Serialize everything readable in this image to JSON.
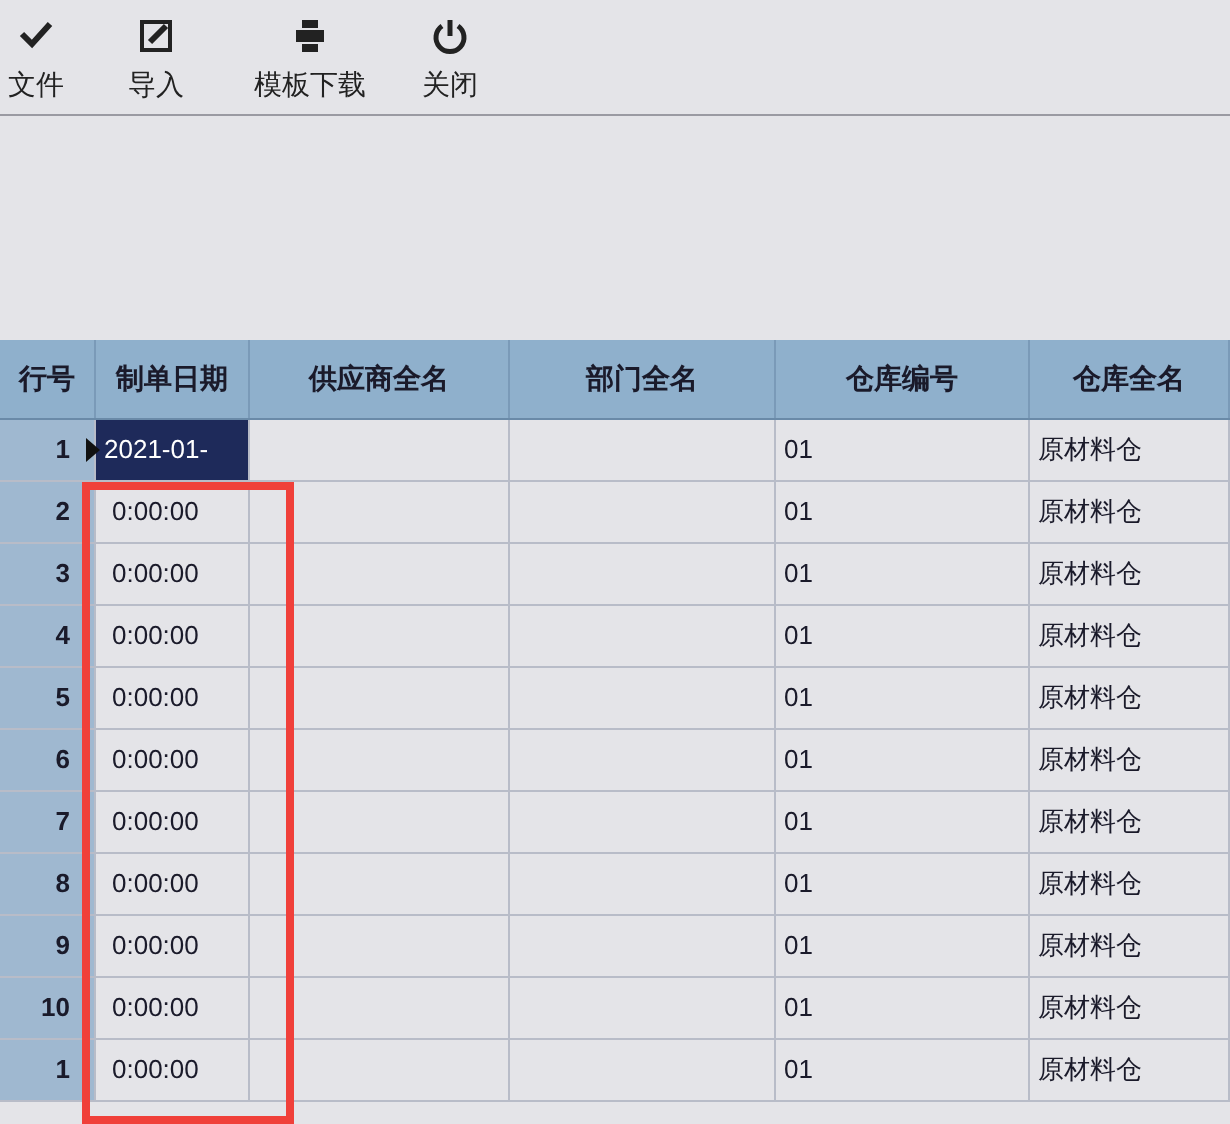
{
  "toolbar": [
    {
      "kind": "check",
      "label": "文件"
    },
    {
      "kind": "edit",
      "label": "导入"
    },
    {
      "kind": "print",
      "label": "模板下载"
    },
    {
      "kind": "power",
      "label": "关闭"
    }
  ],
  "table": {
    "columns": [
      "行号",
      "制单日期",
      "供应商全名",
      "部门全名",
      "仓库编号",
      "仓库全名"
    ],
    "rows": [
      {
        "row_no": "1",
        "date": "2021-01-",
        "warehouse_code": "01",
        "warehouse_name": "原材料仓",
        "selected": true
      },
      {
        "row_no": "2",
        "date": "0:00:00",
        "warehouse_code": "01",
        "warehouse_name": "原材料仓",
        "selected": false
      },
      {
        "row_no": "3",
        "date": "0:00:00",
        "warehouse_code": "01",
        "warehouse_name": "原材料仓",
        "selected": false
      },
      {
        "row_no": "4",
        "date": "0:00:00",
        "warehouse_code": "01",
        "warehouse_name": "原材料仓",
        "selected": false
      },
      {
        "row_no": "5",
        "date": "0:00:00",
        "warehouse_code": "01",
        "warehouse_name": "原材料仓",
        "selected": false
      },
      {
        "row_no": "6",
        "date": "0:00:00",
        "warehouse_code": "01",
        "warehouse_name": "原材料仓",
        "selected": false
      },
      {
        "row_no": "7",
        "date": "0:00:00",
        "warehouse_code": "01",
        "warehouse_name": "原材料仓",
        "selected": false
      },
      {
        "row_no": "8",
        "date": "0:00:00",
        "warehouse_code": "01",
        "warehouse_name": "原材料仓",
        "selected": false
      },
      {
        "row_no": "9",
        "date": "0:00:00",
        "warehouse_code": "01",
        "warehouse_name": "原材料仓",
        "selected": false
      },
      {
        "row_no": "10",
        "date": "0:00:00",
        "warehouse_code": "01",
        "warehouse_name": "原材料仓",
        "selected": false
      },
      {
        "row_no": "1",
        "date": "0:00:00",
        "warehouse_code": "01",
        "warehouse_name": "原材料仓",
        "selected": false
      }
    ]
  }
}
